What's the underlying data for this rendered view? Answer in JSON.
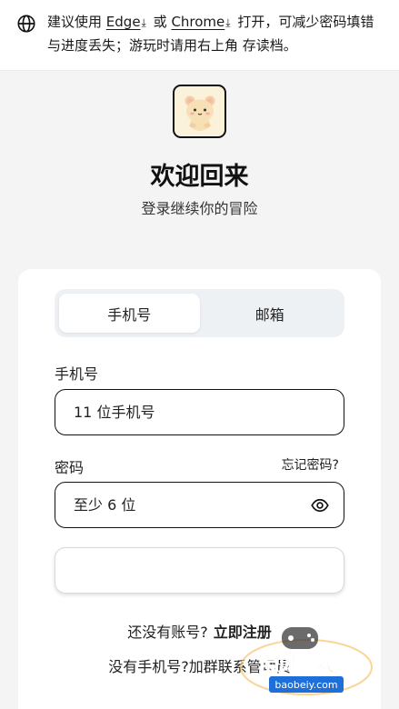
{
  "notice": {
    "pre": "建议使用",
    "edge": "Edge",
    "or": "或",
    "chrome": "Chrome",
    "post": "打开，可减少密码填错与进度丢失；游玩时请用右上角 存读档。",
    "icon": "globe-icon",
    "download_icon": "download-icon"
  },
  "header": {
    "title": "欢迎回来",
    "subtitle": "登录继续你的冒险"
  },
  "tabs": [
    {
      "label": "手机号",
      "active": true
    },
    {
      "label": "邮箱",
      "active": false
    }
  ],
  "form": {
    "phone_label": "手机号",
    "phone_placeholder": "11 位手机号",
    "password_label": "密码",
    "forgot_label": "忘记密码?",
    "password_placeholder": "至少 6 位",
    "eye_icon": "eye-icon"
  },
  "footer": {
    "signup_prompt": "还没有账号?",
    "signup_link": "立即注册",
    "contact_prompt": "没有手机号?",
    "contact_link": "加群联系管理员"
  },
  "watermark": {
    "text": "宝贝游戏网",
    "url": "baobeiy.com"
  },
  "colors": {
    "page_bg": "#f4f4f4",
    "card_bg": "#ffffff",
    "tab_bg": "#eef1f4",
    "logo_bg": "#fbf2dc",
    "watermark_orange": "#f08a1c",
    "watermark_blue": "#1e6fd9"
  }
}
